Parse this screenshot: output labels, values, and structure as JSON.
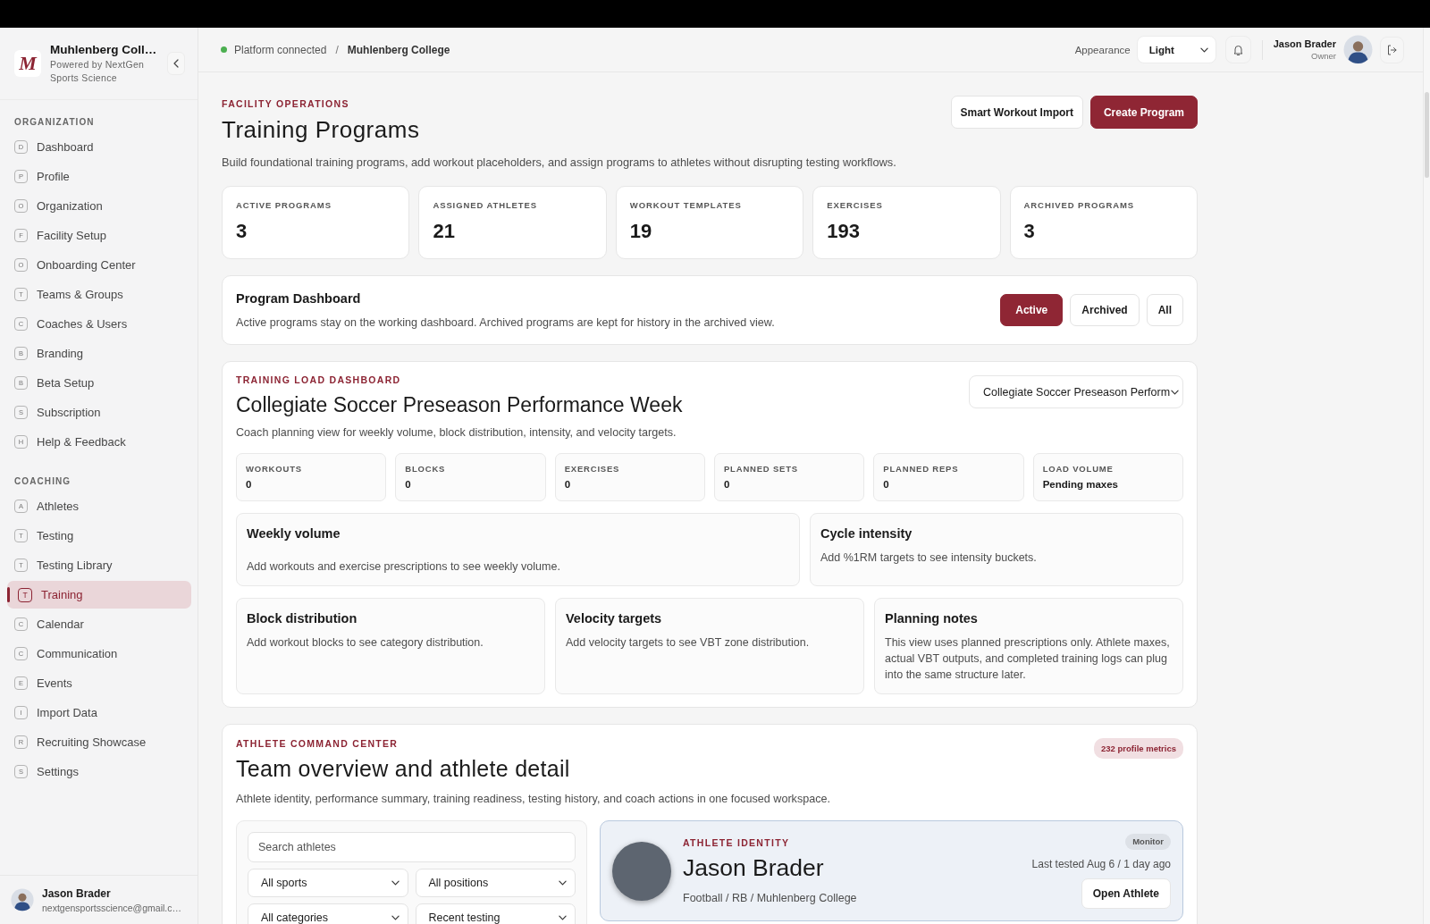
{
  "sidebar": {
    "brand": {
      "logo": "M",
      "name": "Muhlenberg Coll…",
      "tagline": "Powered by NextGen Sports Science"
    },
    "sections": [
      {
        "title": "ORGANIZATION",
        "items": [
          {
            "initial": "D",
            "label": "Dashboard",
            "selected": false
          },
          {
            "initial": "P",
            "label": "Profile",
            "selected": false
          },
          {
            "initial": "O",
            "label": "Organization",
            "selected": false
          },
          {
            "initial": "F",
            "label": "Facility Setup",
            "selected": false
          },
          {
            "initial": "O",
            "label": "Onboarding Center",
            "selected": false
          },
          {
            "initial": "T",
            "label": "Teams & Groups",
            "selected": false
          },
          {
            "initial": "C",
            "label": "Coaches & Users",
            "selected": false
          },
          {
            "initial": "B",
            "label": "Branding",
            "selected": false
          },
          {
            "initial": "B",
            "label": "Beta Setup",
            "selected": false
          },
          {
            "initial": "S",
            "label": "Subscription",
            "selected": false
          },
          {
            "initial": "H",
            "label": "Help & Feedback",
            "selected": false
          }
        ]
      },
      {
        "title": "COACHING",
        "items": [
          {
            "initial": "A",
            "label": "Athletes",
            "selected": false
          },
          {
            "initial": "T",
            "label": "Testing",
            "selected": false
          },
          {
            "initial": "T",
            "label": "Testing Library",
            "selected": false
          },
          {
            "initial": "T",
            "label": "Training",
            "selected": true
          },
          {
            "initial": "C",
            "label": "Calendar",
            "selected": false
          },
          {
            "initial": "C",
            "label": "Communication",
            "selected": false
          },
          {
            "initial": "E",
            "label": "Events",
            "selected": false
          },
          {
            "initial": "I",
            "label": "Import Data",
            "selected": false
          },
          {
            "initial": "R",
            "label": "Recruiting Showcase",
            "selected": false
          },
          {
            "initial": "S",
            "label": "Settings",
            "selected": false
          }
        ]
      }
    ],
    "user": {
      "name": "Jason Brader",
      "email": "nextgensportsscience@gmail.c…"
    }
  },
  "topbar": {
    "status": {
      "label": "Platform connected",
      "online": true
    },
    "separator": "/",
    "breadcrumb": "Muhlenberg College",
    "appearance": {
      "label": "Appearance",
      "value": "Light"
    },
    "user": {
      "name": "Jason Brader",
      "role": "Owner"
    }
  },
  "header": {
    "eyebrow": "FACILITY OPERATIONS",
    "title": "Training Programs",
    "description": "Build foundational training programs, add workout placeholders, and assign programs to athletes without disrupting testing workflows.",
    "actions": [
      {
        "label": "Smart Workout Import",
        "kind": "secondary"
      },
      {
        "label": "Create Program",
        "kind": "primary"
      }
    ]
  },
  "stats": [
    {
      "label": "ACTIVE PROGRAMS",
      "value": "3"
    },
    {
      "label": "ASSIGNED ATHLETES",
      "value": "21"
    },
    {
      "label": "WORKOUT TEMPLATES",
      "value": "19"
    },
    {
      "label": "EXERCISES",
      "value": "193"
    },
    {
      "label": "ARCHIVED PROGRAMS",
      "value": "3"
    }
  ],
  "program_dashboard": {
    "title": "Program Dashboard",
    "description": "Active programs stay on the working dashboard. Archived programs are kept for history in the archived view.",
    "filters": [
      {
        "label": "Active",
        "selected": true
      },
      {
        "label": "Archived",
        "selected": false
      },
      {
        "label": "All",
        "selected": false
      }
    ]
  },
  "training_load": {
    "eyebrow": "TRAINING LOAD DASHBOARD",
    "title": "Collegiate Soccer Preseason Performance Week",
    "description": "Coach planning view for weekly volume, block distribution, intensity, and velocity targets.",
    "program_select": {
      "value": "Collegiate Soccer Preseason Perform"
    },
    "metrics": [
      {
        "label": "WORKOUTS",
        "value": "0"
      },
      {
        "label": "BLOCKS",
        "value": "0"
      },
      {
        "label": "EXERCISES",
        "value": "0"
      },
      {
        "label": "PLANNED SETS",
        "value": "0"
      },
      {
        "label": "PLANNED REPS",
        "value": "0"
      },
      {
        "label": "LOAD VOLUME",
        "value": "Pending maxes"
      }
    ],
    "panel_rows": [
      {
        "panels": [
          {
            "kind": "chart",
            "title": "Weekly volume",
            "text": "Add workouts and exercise prescriptions to see weekly volume."
          },
          {
            "kind": "note",
            "title": "Cycle intensity",
            "text": "Add %1RM targets to see intensity buckets."
          }
        ]
      },
      {
        "panels": [
          {
            "kind": "note",
            "title": "Block distribution",
            "text": "Add workout blocks to see category distribution."
          },
          {
            "kind": "note",
            "title": "Velocity targets",
            "text": "Add velocity targets to see VBT zone distribution."
          },
          {
            "kind": "note",
            "title": "Planning notes",
            "text": "This view uses planned prescriptions only. Athlete maxes, actual VBT outputs, and completed training logs can plug into the same structure later."
          }
        ]
      }
    ]
  },
  "athlete_center": {
    "eyebrow": "ATHLETE COMMAND CENTER",
    "badge": "232 profile metrics",
    "title": "Team overview and athlete detail",
    "description": "Athlete identity, performance summary, training readiness, testing history, and coach actions in one focused workspace.",
    "search": {
      "placeholder": "Search athletes"
    },
    "filters": [
      {
        "value": "All sports"
      },
      {
        "value": "All positions"
      },
      {
        "value": "All categories"
      },
      {
        "value": "Recent testing"
      }
    ],
    "athlete": {
      "eyebrow": "ATHLETE IDENTITY",
      "name": "Jason Brader",
      "details": "Football / RB / Muhlenberg College",
      "status": "Monitor",
      "last_tested": "Last tested Aug 6 / 1 day ago",
      "action": "Open Athlete"
    }
  }
}
